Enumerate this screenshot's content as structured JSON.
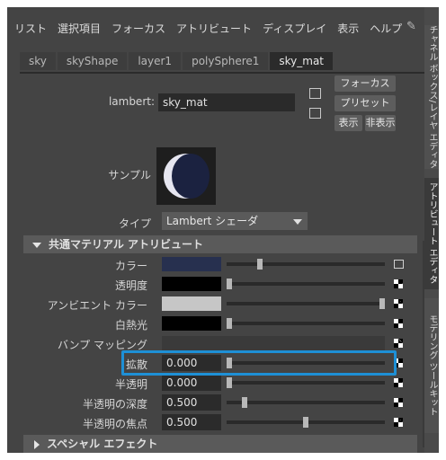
{
  "menu": [
    "リスト",
    "選択項目",
    "フォーカス",
    "アトリビュート",
    "ディスプレイ",
    "表示",
    "ヘルプ"
  ],
  "tabs": [
    {
      "label": "sky",
      "active": false
    },
    {
      "label": "skyShape",
      "active": false
    },
    {
      "label": "layer1",
      "active": false
    },
    {
      "label": "polySphere1",
      "active": false
    },
    {
      "label": "sky_mat",
      "active": true
    }
  ],
  "node": {
    "label": "lambert:",
    "value": "sky_mat"
  },
  "buttons": {
    "focus": "フォーカス",
    "preset": "プリセット",
    "show": "表示",
    "hide": "非表示"
  },
  "sample": {
    "label": "サンプル"
  },
  "type": {
    "label": "タイプ",
    "value": "Lambert シェーダ"
  },
  "section_common": "共通マテリアル アトリビュート",
  "section_special": "スペシャル エフェクト",
  "attributes": [
    {
      "label": "カラー",
      "kind": "color",
      "color": "#27304f",
      "slider": 0.2,
      "icon": "map-icon"
    },
    {
      "label": "透明度",
      "kind": "color",
      "color": "#000000",
      "slider": 0.0,
      "icon": "checker-icon"
    },
    {
      "label": "アンビエント カラー",
      "kind": "color",
      "color": "#c6c6c6",
      "slider": 1.0,
      "icon": "checker-icon"
    },
    {
      "label": "白熱光",
      "kind": "color",
      "color": "#000000",
      "slider": 0.0,
      "icon": "checker-icon"
    },
    {
      "label": "バンプ マッピング",
      "kind": "bump",
      "icon": "checker-icon"
    },
    {
      "label": "拡散",
      "kind": "num",
      "value": "0.000",
      "slider": 0.0,
      "icon": "checker-icon"
    },
    {
      "label": "半透明",
      "kind": "num",
      "value": "0.000",
      "slider": 0.0,
      "icon": "checker-icon"
    },
    {
      "label": "半透明の深度",
      "kind": "num",
      "value": "0.500",
      "slider": 0.1,
      "icon": "checker-icon"
    },
    {
      "label": "半透明の焦点",
      "kind": "num",
      "value": "0.500",
      "slider": 0.5,
      "icon": "checker-icon"
    }
  ],
  "side_tabs": [
    {
      "label": "チャネル ボックス/レイヤ エディタ",
      "active": false
    },
    {
      "label": "アトリビュート エディタ",
      "active": true
    },
    {
      "label": "モデリング ツールキット",
      "active": false
    }
  ]
}
